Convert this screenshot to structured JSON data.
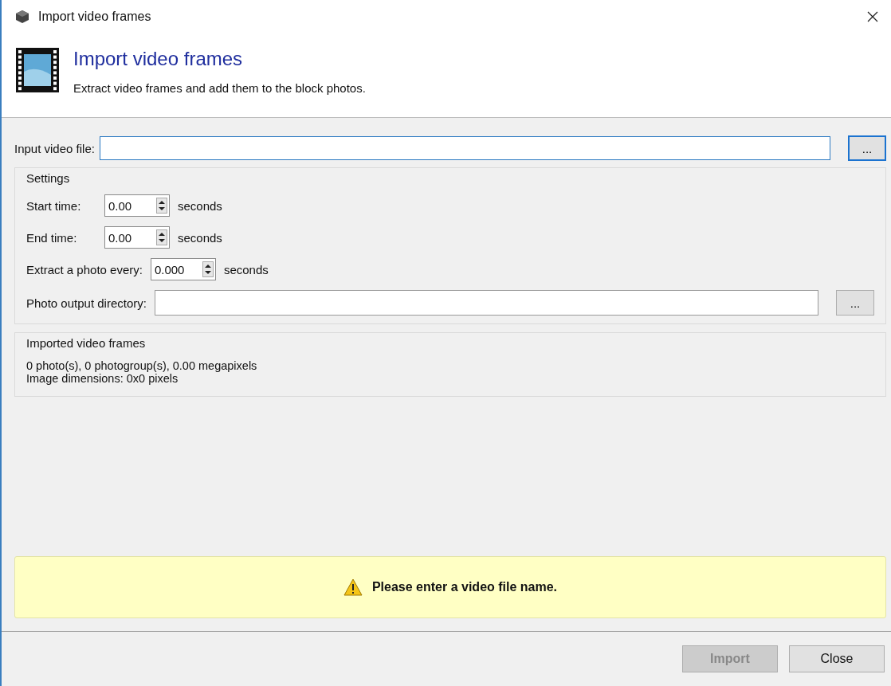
{
  "window": {
    "title": "Import video frames"
  },
  "header": {
    "title": "Import video frames",
    "subtitle": "Extract video frames and add them to the block photos."
  },
  "input_file": {
    "label": "Input video file:",
    "focused": true,
    "browse": "..."
  },
  "settings": {
    "title": "Settings",
    "spinners": [
      {
        "label": "Start time:",
        "value": "0.00",
        "unit": "seconds"
      },
      {
        "label": "End time:",
        "value": "0.00",
        "unit": "seconds"
      },
      {
        "label": "Extract a photo every:",
        "value": "0.000",
        "unit": "seconds"
      }
    ],
    "output_dir": {
      "label": "Photo output directory:",
      "browse": "..."
    }
  },
  "imported": {
    "title": "Imported video frames",
    "lines": [
      "0 photo(s), 0 photogroup(s), 0.00 megapixels",
      "Image dimensions: 0x0 pixels"
    ]
  },
  "warning": {
    "text": "Please enter a video file name."
  },
  "buttons": [
    {
      "label": "Import",
      "disabled": true
    },
    {
      "label": "Close",
      "disabled": false
    }
  ]
}
